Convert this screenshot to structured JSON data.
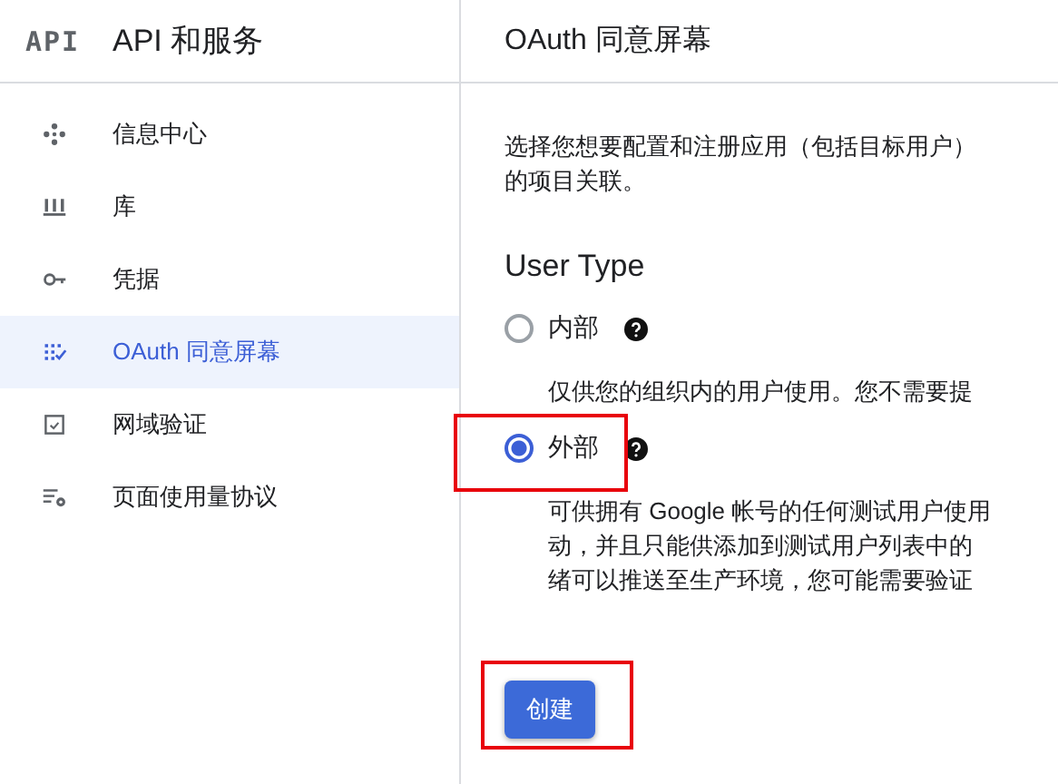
{
  "header": {
    "logo": "API",
    "title": "API 和服务"
  },
  "sidebar": {
    "items": [
      {
        "label": "信息中心",
        "kind": "dashboard",
        "selected": false
      },
      {
        "label": "库",
        "kind": "library",
        "selected": false
      },
      {
        "label": "凭据",
        "kind": "credentials",
        "selected": false
      },
      {
        "label": "OAuth 同意屏幕",
        "kind": "consent",
        "selected": true
      },
      {
        "label": "网域验证",
        "kind": "verification",
        "selected": false
      },
      {
        "label": "页面使用量协议",
        "kind": "agreements",
        "selected": false
      }
    ]
  },
  "page": {
    "title": "OAuth 同意屏幕",
    "intro": [
      "选择您想要配置和注册应用（包括目标用户）",
      "的项目关联。"
    ],
    "section_title": "User Type",
    "options": [
      {
        "label": "内部",
        "selected": false,
        "description": [
          "仅供您的组织内的用户使用。您不需要提"
        ]
      },
      {
        "label": "外部",
        "selected": true,
        "description": [
          "可供拥有 Google 帐号的任何测试用户使用",
          "动，并且只能供添加到测试用户列表中的",
          "绪可以推送至生产环境，您可能需要验证"
        ]
      }
    ],
    "create_button": "创建"
  }
}
